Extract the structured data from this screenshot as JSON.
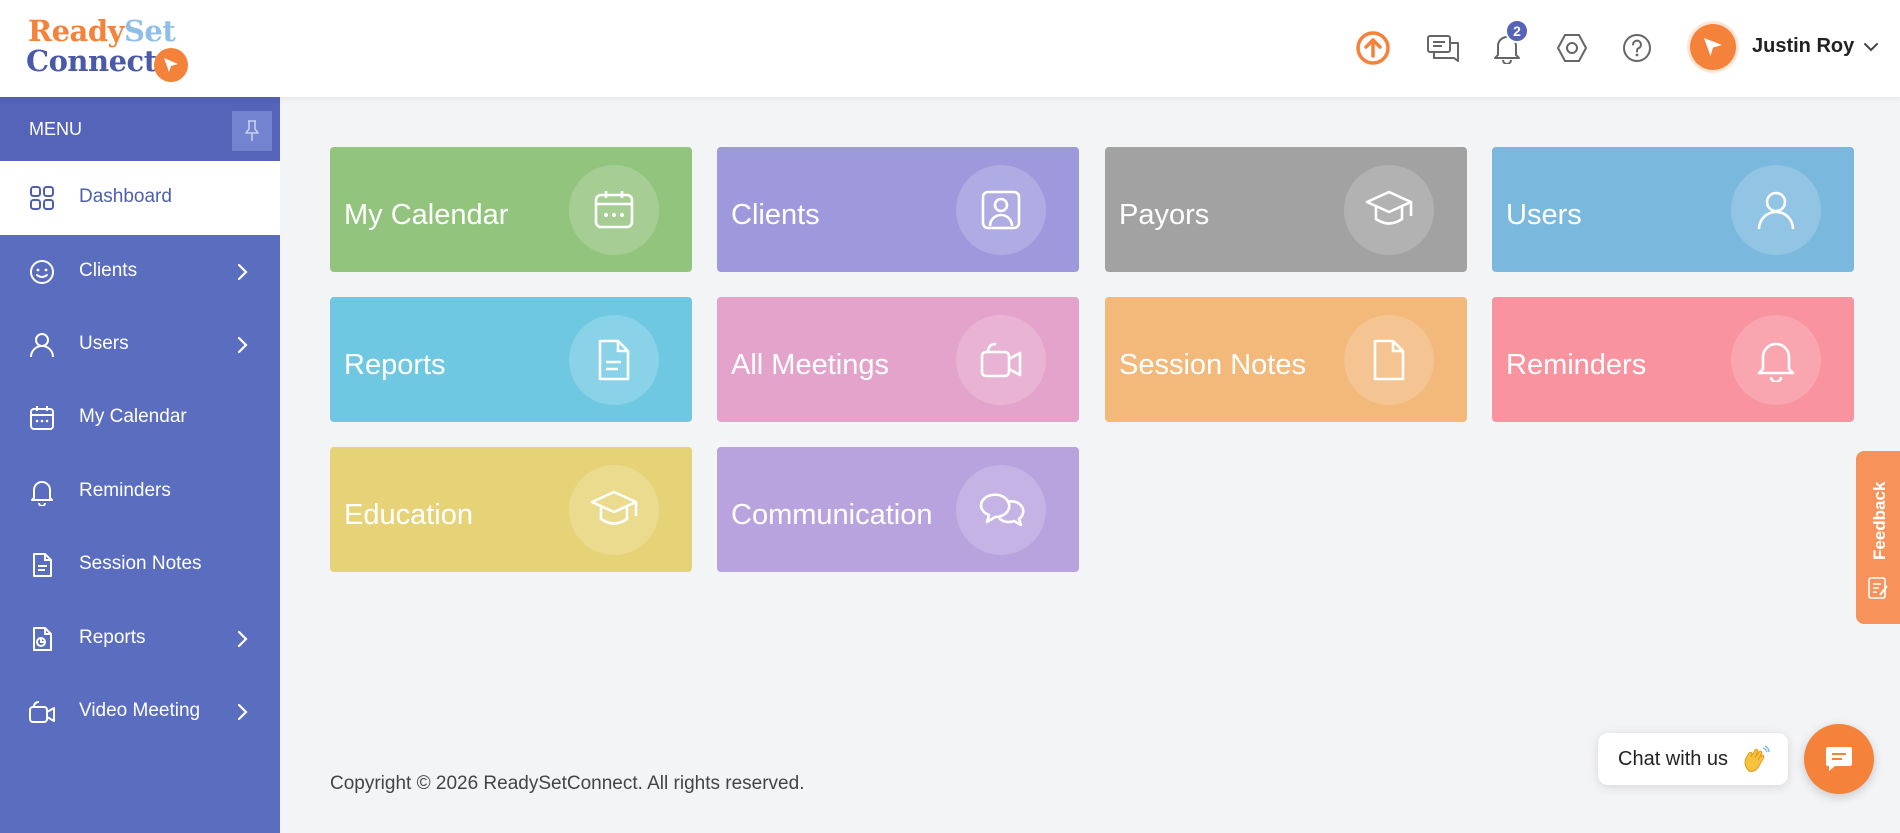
{
  "brand": {
    "line1_a": "Ready",
    "line1_b": "Set",
    "line2": "Connect"
  },
  "header": {
    "notification_count": "2",
    "user_name": "Justin Roy"
  },
  "sidebar": {
    "menu_title": "MENU",
    "items": [
      {
        "label": "Dashboard",
        "icon": "grid-icon"
      },
      {
        "label": "Clients",
        "icon": "smile-icon"
      },
      {
        "label": "Users",
        "icon": "user-icon"
      },
      {
        "label": "My Calendar",
        "icon": "calendar-icon"
      },
      {
        "label": "Reminders",
        "icon": "bell-icon"
      },
      {
        "label": "Session Notes",
        "icon": "document-icon"
      },
      {
        "label": "Reports",
        "icon": "report-icon"
      },
      {
        "label": "Video Meeting",
        "icon": "video-icon"
      }
    ]
  },
  "tiles": [
    {
      "label": "My Calendar",
      "color": "#93c47d",
      "icon": "calendar-icon"
    },
    {
      "label": "Clients",
      "color": "#9e99dd",
      "icon": "contact-icon"
    },
    {
      "label": "Payors",
      "color": "#a2a2a2",
      "icon": "graduation-cap-icon"
    },
    {
      "label": "Users",
      "color": "#7ab8de",
      "icon": "user-icon"
    },
    {
      "label": "Reports",
      "color": "#6fc8e2",
      "icon": "document-icon"
    },
    {
      "label": "All Meetings",
      "color": "#e4a3cb",
      "icon": "video-icon"
    },
    {
      "label": "Session Notes",
      "color": "#f2b97a",
      "icon": "file-icon"
    },
    {
      "label": "Reminders",
      "color": "#f8939f",
      "icon": "bell-icon"
    },
    {
      "label": "Education",
      "color": "#e7d377",
      "icon": "graduation-cap-icon"
    },
    {
      "label": "Communication",
      "color": "#b8a3de",
      "icon": "chat-bubbles-icon"
    }
  ],
  "footer": {
    "copyright": "Copyright © 2026 ReadySetConnect. All rights reserved."
  },
  "feedback": {
    "label": "Feedback"
  },
  "chat": {
    "label": "Chat with us"
  },
  "colors": {
    "accent": "#f5823a",
    "sidebar": "#5a6dbf",
    "sidebar_header": "#5563b8"
  }
}
